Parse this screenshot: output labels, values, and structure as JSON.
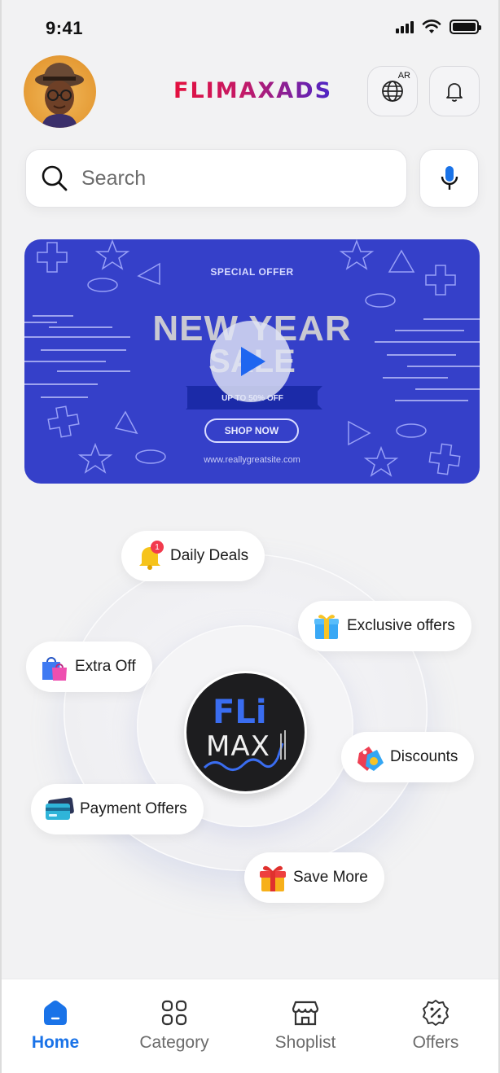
{
  "status_bar": {
    "time": "9:41"
  },
  "header": {
    "brand": "FLIMAXADS",
    "language_badge": "AR"
  },
  "search": {
    "placeholder": "Search"
  },
  "banner": {
    "eyebrow": "SPECIAL OFFER",
    "title_line1": "NEW YEAR",
    "title_line2": "SALE",
    "ribbon": "UP TO 50% OFF",
    "cta": "SHOP NOW",
    "url": "www.reallygreatsite.com"
  },
  "center_logo": {
    "line1": "FLi",
    "line2": "MAX"
  },
  "offers": {
    "daily_deals": {
      "label": "Daily Deals",
      "badge": "1"
    },
    "exclusive_offers": {
      "label": "Exclusive offers"
    },
    "extra_off": {
      "label": "Extra Off"
    },
    "discounts": {
      "label": "Discounts"
    },
    "payment_offers": {
      "label": "Payment Offers"
    },
    "save_more": {
      "label": "Save More"
    }
  },
  "bottom_nav": {
    "items": [
      {
        "label": "Home",
        "active": true
      },
      {
        "label": "Category",
        "active": false
      },
      {
        "label": "Shoplist",
        "active": false
      },
      {
        "label": "Offers",
        "active": false
      }
    ]
  },
  "colors": {
    "accent": "#1a73e8",
    "banner_bg": "#3540c9",
    "brand_red": "#e4103d",
    "brand_purple": "#4b25c8"
  }
}
